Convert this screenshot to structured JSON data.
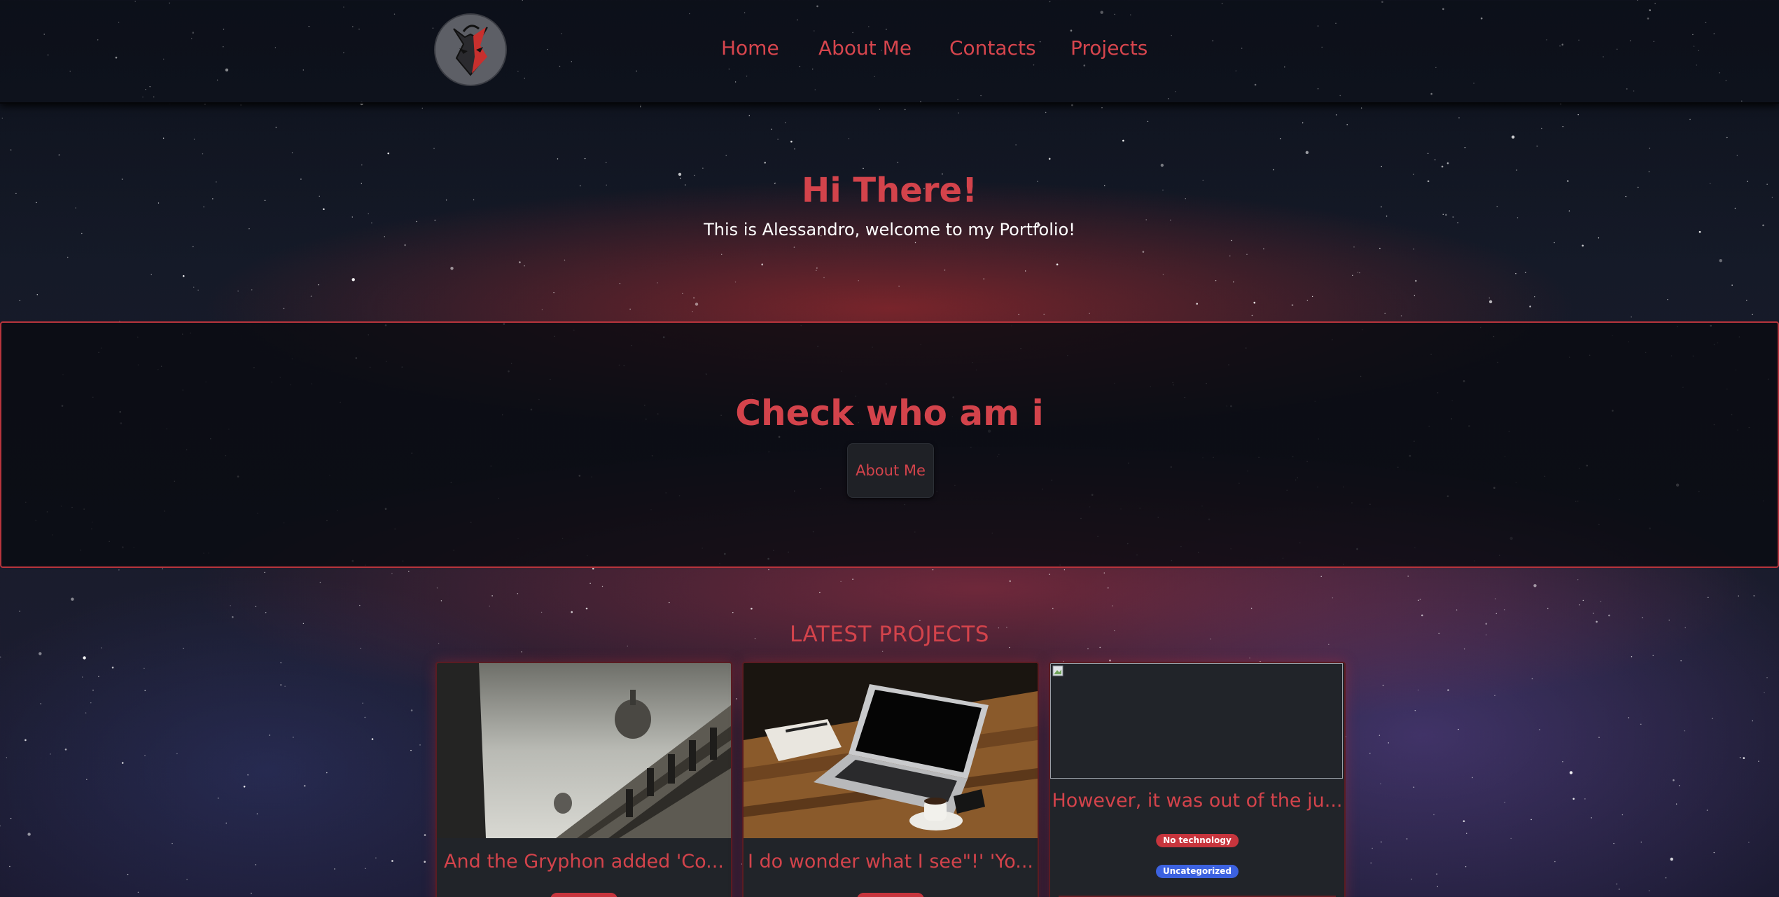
{
  "nav": {
    "links": [
      {
        "label": "Home"
      },
      {
        "label": "About Me"
      },
      {
        "label": "Contacts"
      },
      {
        "label": "Projects"
      }
    ]
  },
  "hero": {
    "title": "Hi There!",
    "subtitle": "This is Alessandro, welcome to my Portfolio!"
  },
  "banner": {
    "title": "Check who am i",
    "button_label": "About Me"
  },
  "projects": {
    "section_title": "LATEST PROJECTS",
    "cards": [
      {
        "title": "And the Gryphon added 'Co...",
        "image": "building-photo"
      },
      {
        "title": "I do wonder what I see\"!' 'Yo...",
        "image": "laptop-photo"
      },
      {
        "title": "However, it was out of the ju...",
        "image": "broken-image",
        "badges": [
          "No technology",
          "Uncategorized"
        ]
      }
    ]
  },
  "colors": {
    "accent": "#d3434b",
    "badge_red": "#c7353d",
    "badge_blue": "#3c62e0"
  }
}
